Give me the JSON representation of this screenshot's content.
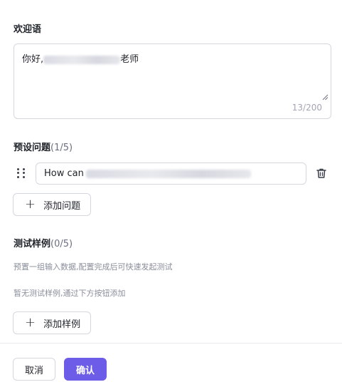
{
  "welcome": {
    "title": "欢迎语",
    "text_prefix": "你好,",
    "text_suffix": "老师",
    "char_count": "13/200"
  },
  "preset_questions": {
    "title": "预设问题",
    "count": "(1/5)",
    "items": [
      {
        "text": "How can"
      }
    ],
    "add_label": "添加问题"
  },
  "test_cases": {
    "title": "测试样例",
    "count": "(0/5)",
    "description": "预置一组输入数据,配置完成后可快速发起测试",
    "empty_hint": "暂无测试样例,通过下方按钮添加",
    "add_label": "添加样例"
  },
  "footer": {
    "cancel_label": "取消",
    "confirm_label": "确认"
  },
  "colors": {
    "accent": "#6c5ce7",
    "border": "#d5d7de",
    "muted_text": "#8a8e9b"
  },
  "icons": {
    "drag": "drag-handle-icon",
    "delete": "trash-icon",
    "add": "plus-icon"
  }
}
